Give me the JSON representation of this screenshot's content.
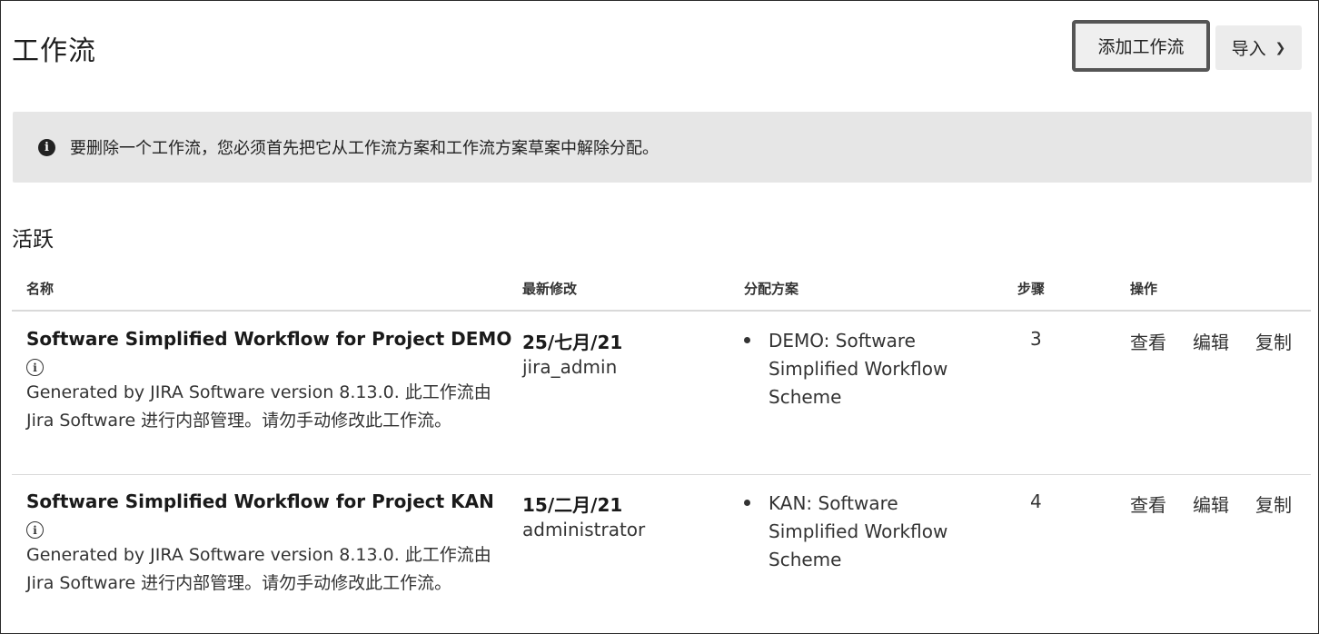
{
  "header": {
    "title": "工作流",
    "add_button": "添加工作流",
    "import_button": "导入",
    "import_icon": "chevron-down-icon"
  },
  "notice": {
    "icon": "info-icon",
    "text": "要删除一个工作流，您必须首先把它从工作流方案和工作流方案草案中解除分配。"
  },
  "section": {
    "title": "活跃"
  },
  "table": {
    "columns": {
      "name": "名称",
      "last_modified": "最新修改",
      "schemes": "分配方案",
      "steps": "步骤",
      "actions": "操作"
    },
    "rows": [
      {
        "name": "Software Simplified Workflow for Project DEMO",
        "description": "Generated by JIRA Software version 8.13.0. 此工作流由 Jira Software 进行内部管理。请勿手动修改此工作流。",
        "modified_date": "25/七月/21",
        "modified_by": "jira_admin",
        "scheme": "DEMO: Software Simplified Workflow Scheme",
        "steps": "3",
        "actions": {
          "view": "查看",
          "edit": "编辑",
          "copy": "复制"
        }
      },
      {
        "name": "Software Simplified Workflow for Project KAN",
        "description": "Generated by JIRA Software version 8.13.0. 此工作流由 Jira Software 进行内部管理。请勿手动修改此工作流。",
        "modified_date": "15/二月/21",
        "modified_by": "administrator",
        "scheme": "KAN: Software Simplified Workflow Scheme",
        "steps": "4",
        "actions": {
          "view": "查看",
          "edit": "编辑",
          "copy": "复制"
        }
      }
    ]
  }
}
